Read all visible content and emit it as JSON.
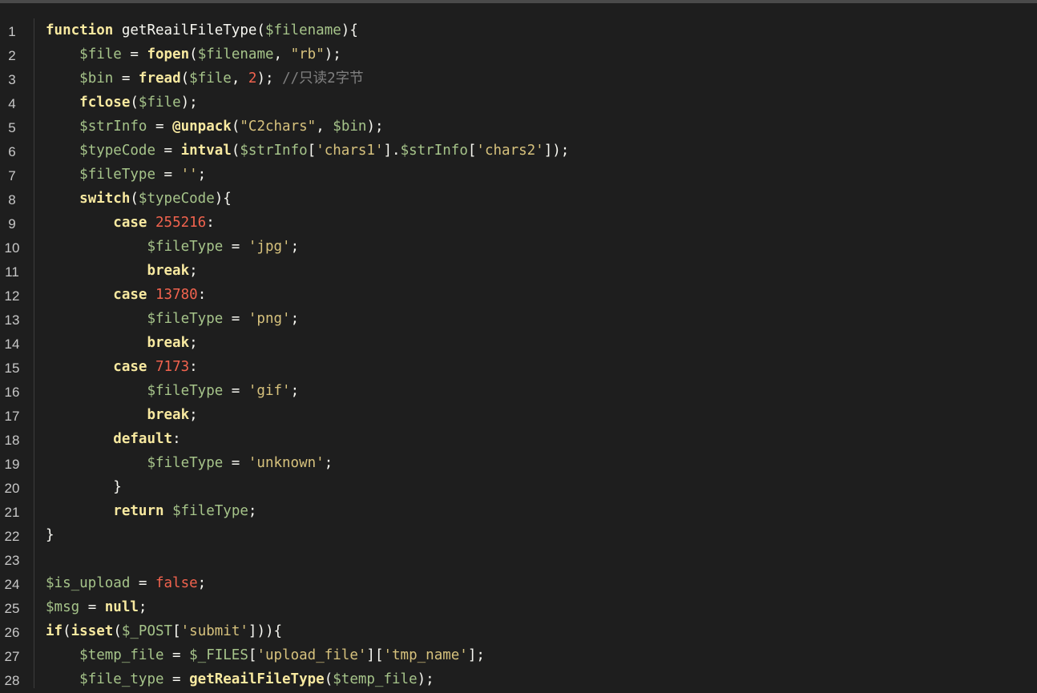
{
  "colors": {
    "background": "#1e1e1e",
    "keyword": "#f8e9a0",
    "variable": "#a6c48a",
    "string": "#d7c27d",
    "number": "#f1634e",
    "comment": "#808080",
    "plain": "#f8f8f2",
    "line_number": "#c8c8c8"
  },
  "lines": [
    {
      "n": "1",
      "tokens": [
        {
          "t": "kw",
          "v": "function"
        },
        {
          "t": "id",
          "v": " getReailFileType("
        },
        {
          "t": "var",
          "v": "$filename"
        },
        {
          "t": "pun",
          "v": "){"
        }
      ]
    },
    {
      "n": "2",
      "tokens": [
        {
          "t": "pun",
          "v": "    "
        },
        {
          "t": "var",
          "v": "$file"
        },
        {
          "t": "pun",
          "v": " = "
        },
        {
          "t": "kw",
          "v": "fopen"
        },
        {
          "t": "pun",
          "v": "("
        },
        {
          "t": "var",
          "v": "$filename"
        },
        {
          "t": "pun",
          "v": ", "
        },
        {
          "t": "str",
          "v": "\"rb\""
        },
        {
          "t": "pun",
          "v": ");"
        }
      ]
    },
    {
      "n": "3",
      "tokens": [
        {
          "t": "pun",
          "v": "    "
        },
        {
          "t": "var",
          "v": "$bin"
        },
        {
          "t": "pun",
          "v": " = "
        },
        {
          "t": "kw",
          "v": "fread"
        },
        {
          "t": "pun",
          "v": "("
        },
        {
          "t": "var",
          "v": "$file"
        },
        {
          "t": "pun",
          "v": ", "
        },
        {
          "t": "num",
          "v": "2"
        },
        {
          "t": "pun",
          "v": "); "
        },
        {
          "t": "com",
          "v": "//只读2字节"
        }
      ]
    },
    {
      "n": "4",
      "tokens": [
        {
          "t": "pun",
          "v": "    "
        },
        {
          "t": "kw",
          "v": "fclose"
        },
        {
          "t": "pun",
          "v": "("
        },
        {
          "t": "var",
          "v": "$file"
        },
        {
          "t": "pun",
          "v": ");"
        }
      ]
    },
    {
      "n": "5",
      "tokens": [
        {
          "t": "pun",
          "v": "    "
        },
        {
          "t": "var",
          "v": "$strInfo"
        },
        {
          "t": "pun",
          "v": " = "
        },
        {
          "t": "kw",
          "v": "@unpack"
        },
        {
          "t": "pun",
          "v": "("
        },
        {
          "t": "str",
          "v": "\"C2chars\""
        },
        {
          "t": "pun",
          "v": ", "
        },
        {
          "t": "var",
          "v": "$bin"
        },
        {
          "t": "pun",
          "v": ");"
        }
      ]
    },
    {
      "n": "6",
      "tokens": [
        {
          "t": "pun",
          "v": "    "
        },
        {
          "t": "var",
          "v": "$typeCode"
        },
        {
          "t": "pun",
          "v": " = "
        },
        {
          "t": "kw",
          "v": "intval"
        },
        {
          "t": "pun",
          "v": "("
        },
        {
          "t": "var",
          "v": "$strInfo"
        },
        {
          "t": "pun",
          "v": "["
        },
        {
          "t": "str",
          "v": "'chars1'"
        },
        {
          "t": "pun",
          "v": "]."
        },
        {
          "t": "var",
          "v": "$strInfo"
        },
        {
          "t": "pun",
          "v": "["
        },
        {
          "t": "str",
          "v": "'chars2'"
        },
        {
          "t": "pun",
          "v": "]);"
        }
      ]
    },
    {
      "n": "7",
      "tokens": [
        {
          "t": "pun",
          "v": "    "
        },
        {
          "t": "var",
          "v": "$fileType"
        },
        {
          "t": "pun",
          "v": " = "
        },
        {
          "t": "str",
          "v": "''"
        },
        {
          "t": "pun",
          "v": ";"
        }
      ]
    },
    {
      "n": "8",
      "tokens": [
        {
          "t": "pun",
          "v": "    "
        },
        {
          "t": "kw",
          "v": "switch"
        },
        {
          "t": "pun",
          "v": "("
        },
        {
          "t": "var",
          "v": "$typeCode"
        },
        {
          "t": "pun",
          "v": "){"
        }
      ]
    },
    {
      "n": "9",
      "tokens": [
        {
          "t": "pun",
          "v": "        "
        },
        {
          "t": "kw",
          "v": "case"
        },
        {
          "t": "pun",
          "v": " "
        },
        {
          "t": "num",
          "v": "255216"
        },
        {
          "t": "pun",
          "v": ":"
        }
      ]
    },
    {
      "n": "10",
      "tokens": [
        {
          "t": "pun",
          "v": "            "
        },
        {
          "t": "var",
          "v": "$fileType"
        },
        {
          "t": "pun",
          "v": " = "
        },
        {
          "t": "str",
          "v": "'jpg'"
        },
        {
          "t": "pun",
          "v": ";"
        }
      ]
    },
    {
      "n": "11",
      "tokens": [
        {
          "t": "pun",
          "v": "            "
        },
        {
          "t": "kw",
          "v": "break"
        },
        {
          "t": "pun",
          "v": ";"
        }
      ]
    },
    {
      "n": "12",
      "tokens": [
        {
          "t": "pun",
          "v": "        "
        },
        {
          "t": "kw",
          "v": "case"
        },
        {
          "t": "pun",
          "v": " "
        },
        {
          "t": "num",
          "v": "13780"
        },
        {
          "t": "pun",
          "v": ":"
        }
      ]
    },
    {
      "n": "13",
      "tokens": [
        {
          "t": "pun",
          "v": "            "
        },
        {
          "t": "var",
          "v": "$fileType"
        },
        {
          "t": "pun",
          "v": " = "
        },
        {
          "t": "str",
          "v": "'png'"
        },
        {
          "t": "pun",
          "v": ";"
        }
      ]
    },
    {
      "n": "14",
      "tokens": [
        {
          "t": "pun",
          "v": "            "
        },
        {
          "t": "kw",
          "v": "break"
        },
        {
          "t": "pun",
          "v": ";"
        }
      ]
    },
    {
      "n": "15",
      "tokens": [
        {
          "t": "pun",
          "v": "        "
        },
        {
          "t": "kw",
          "v": "case"
        },
        {
          "t": "pun",
          "v": " "
        },
        {
          "t": "num",
          "v": "7173"
        },
        {
          "t": "pun",
          "v": ":"
        }
      ]
    },
    {
      "n": "16",
      "tokens": [
        {
          "t": "pun",
          "v": "            "
        },
        {
          "t": "var",
          "v": "$fileType"
        },
        {
          "t": "pun",
          "v": " = "
        },
        {
          "t": "str",
          "v": "'gif'"
        },
        {
          "t": "pun",
          "v": ";"
        }
      ]
    },
    {
      "n": "17",
      "tokens": [
        {
          "t": "pun",
          "v": "            "
        },
        {
          "t": "kw",
          "v": "break"
        },
        {
          "t": "pun",
          "v": ";"
        }
      ]
    },
    {
      "n": "18",
      "tokens": [
        {
          "t": "pun",
          "v": "        "
        },
        {
          "t": "kw",
          "v": "default"
        },
        {
          "t": "pun",
          "v": ":"
        }
      ]
    },
    {
      "n": "19",
      "tokens": [
        {
          "t": "pun",
          "v": "            "
        },
        {
          "t": "var",
          "v": "$fileType"
        },
        {
          "t": "pun",
          "v": " = "
        },
        {
          "t": "str",
          "v": "'unknown'"
        },
        {
          "t": "pun",
          "v": ";"
        }
      ]
    },
    {
      "n": "20",
      "tokens": [
        {
          "t": "pun",
          "v": "        }"
        }
      ]
    },
    {
      "n": "21",
      "tokens": [
        {
          "t": "pun",
          "v": "        "
        },
        {
          "t": "kw",
          "v": "return"
        },
        {
          "t": "pun",
          "v": " "
        },
        {
          "t": "var",
          "v": "$fileType"
        },
        {
          "t": "pun",
          "v": ";"
        }
      ]
    },
    {
      "n": "22",
      "tokens": [
        {
          "t": "pun",
          "v": "}"
        }
      ]
    },
    {
      "n": "23",
      "tokens": []
    },
    {
      "n": "24",
      "tokens": [
        {
          "t": "var",
          "v": "$is_upload"
        },
        {
          "t": "pun",
          "v": " = "
        },
        {
          "t": "num",
          "v": "false"
        },
        {
          "t": "pun",
          "v": ";"
        }
      ]
    },
    {
      "n": "25",
      "tokens": [
        {
          "t": "var",
          "v": "$msg"
        },
        {
          "t": "pun",
          "v": " = "
        },
        {
          "t": "kw",
          "v": "null"
        },
        {
          "t": "pun",
          "v": ";"
        }
      ]
    },
    {
      "n": "26",
      "tokens": [
        {
          "t": "kw",
          "v": "if"
        },
        {
          "t": "pun",
          "v": "("
        },
        {
          "t": "kw",
          "v": "isset"
        },
        {
          "t": "pun",
          "v": "("
        },
        {
          "t": "var",
          "v": "$_POST"
        },
        {
          "t": "pun",
          "v": "["
        },
        {
          "t": "str",
          "v": "'submit'"
        },
        {
          "t": "pun",
          "v": "])){"
        }
      ]
    },
    {
      "n": "27",
      "tokens": [
        {
          "t": "pun",
          "v": "    "
        },
        {
          "t": "var",
          "v": "$temp_file"
        },
        {
          "t": "pun",
          "v": " = "
        },
        {
          "t": "var",
          "v": "$_FILES"
        },
        {
          "t": "pun",
          "v": "["
        },
        {
          "t": "str",
          "v": "'upload_file'"
        },
        {
          "t": "pun",
          "v": "]["
        },
        {
          "t": "str",
          "v": "'tmp_name'"
        },
        {
          "t": "pun",
          "v": "];"
        }
      ]
    },
    {
      "n": "28",
      "tokens": [
        {
          "t": "pun",
          "v": "    "
        },
        {
          "t": "var",
          "v": "$file_type"
        },
        {
          "t": "pun",
          "v": " = "
        },
        {
          "t": "kw",
          "v": "getReailFileType"
        },
        {
          "t": "pun",
          "v": "("
        },
        {
          "t": "var",
          "v": "$temp_file"
        },
        {
          "t": "pun",
          "v": ");"
        }
      ]
    }
  ]
}
